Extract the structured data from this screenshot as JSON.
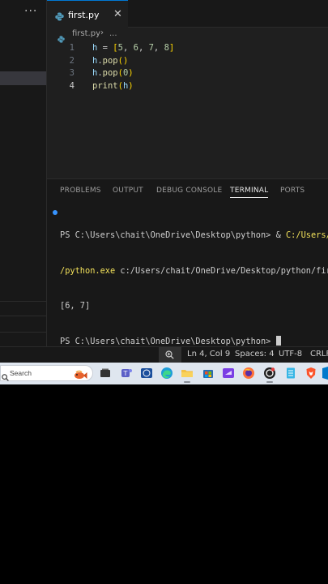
{
  "sidebar": {
    "more_label": "···"
  },
  "editor_tab": {
    "filename": "first.py",
    "close_glyph": "✕"
  },
  "breadcrumb": {
    "file": "first.py",
    "separator": "›",
    "rest": "..."
  },
  "editor": {
    "line_numbers": [
      "1",
      "2",
      "3",
      "4"
    ],
    "active_line": "4",
    "lines": [
      "h = [5, 6, 7, 8]",
      "h.pop()",
      "h.pop(0)",
      "print(h)"
    ]
  },
  "panel": {
    "tabs": [
      "PROBLEMS",
      "OUTPUT",
      "DEBUG CONSOLE",
      "TERMINAL",
      "PORTS"
    ],
    "active_tab": "TERMINAL"
  },
  "terminal": {
    "line1_prompt": "PS C:\\Users\\chait\\OneDrive\\Desktop\\python> & ",
    "line1_cmd": "C:/Users/c",
    "line2_cmd": "/python.exe",
    "line2_rest": " c:/Users/chait/OneDrive/Desktop/python/firs",
    "line3": "[6, 7]",
    "line4_prompt": "PS C:\\Users\\chait\\OneDrive\\Desktop\\python> "
  },
  "statusbar": {
    "position": "Ln 4, Col 9",
    "spaces": "Spaces: 4",
    "encoding": "UTF-8",
    "eol": "CRLF"
  },
  "taskbar": {
    "search_placeholder": "Search",
    "icons": [
      "task-view-icon",
      "teams-icon",
      "dell-icon",
      "edge-icon",
      "file-explorer-icon",
      "store-icon",
      "clipchamp-icon",
      "firefox-icon",
      "chatgpt-icon",
      "notepad-icon",
      "brave-icon",
      "vscode-icon"
    ]
  },
  "colors": {
    "accent": "#0078d4",
    "terminal_command": "#f1e05a",
    "terminal_dot": "#3794ff"
  }
}
